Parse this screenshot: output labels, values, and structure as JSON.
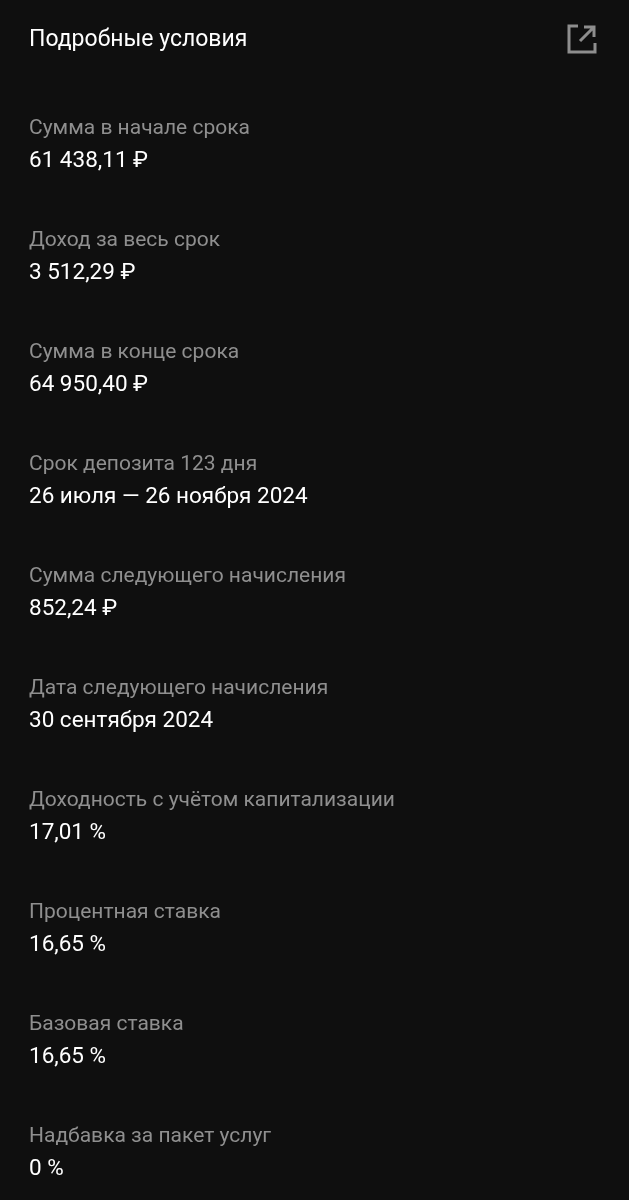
{
  "header": {
    "title": "Подробные условия"
  },
  "items": [
    {
      "label": "Сумма в начале срока",
      "value": "61 438,11 ₽"
    },
    {
      "label": "Доход за весь срок",
      "value": "3 512,29 ₽"
    },
    {
      "label": "Сумма в конце срока",
      "value": "64 950,40 ₽"
    },
    {
      "label": "Срок депозита 123 дня",
      "value": "26 июля — 26 ноября 2024"
    },
    {
      "label": "Сумма следующего начисления",
      "value": "852,24 ₽"
    },
    {
      "label": "Дата следующего начисления",
      "value": "30 сентября 2024"
    },
    {
      "label": "Доходность с учётом капитализации",
      "value": "17,01 %"
    },
    {
      "label": "Процентная ставка",
      "value": "16,65 %"
    },
    {
      "label": "Базовая ставка",
      "value": "16,65 %"
    },
    {
      "label": "Надбавка за пакет услуг",
      "value": "0 %"
    }
  ]
}
